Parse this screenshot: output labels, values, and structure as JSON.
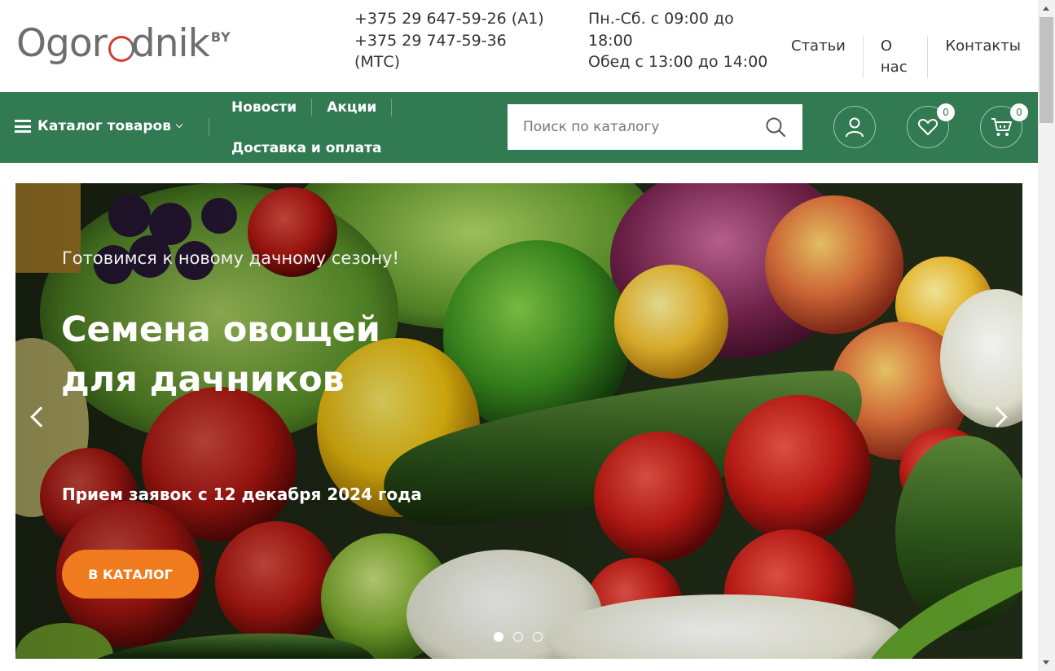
{
  "header": {
    "logo": {
      "text": "Ogorodnik",
      "suffix": "BY"
    },
    "phones": [
      "+375 29 647-59-26 (A1)",
      "+375 29 747-59-36",
      "(МТС)"
    ],
    "hours": [
      "Пн.-Сб. с 09:00 до",
      "18:00",
      "Обед с 13:00 до 14:00"
    ],
    "links": [
      "Статьи",
      "О нас",
      "Контакты"
    ]
  },
  "nav": {
    "catalog_label": "Каталог товаров",
    "links_row1": [
      "Новости",
      "Акции"
    ],
    "link_row2": "Доставка и оплата",
    "search": {
      "placeholder": "Поиск по каталогу"
    },
    "wishlist_count": "0",
    "cart_count": "0"
  },
  "hero": {
    "subtitle": "Готовимся к новому дачному сезону!",
    "title": "Семена овощей для дачников",
    "date_line": "Прием заявок с 12 декабря 2024 года",
    "button_label": "В КАТАЛОГ",
    "slides_total": 3,
    "active_slide": 1
  },
  "colors": {
    "brand_green": "#317a52",
    "accent_orange": "#f07a1e",
    "logo_red": "#d63b2f"
  },
  "icons": [
    "hamburger-icon",
    "chevron-down-icon",
    "search-icon",
    "user-icon",
    "heart-icon",
    "cart-icon",
    "chevron-left-icon",
    "chevron-right-icon"
  ]
}
